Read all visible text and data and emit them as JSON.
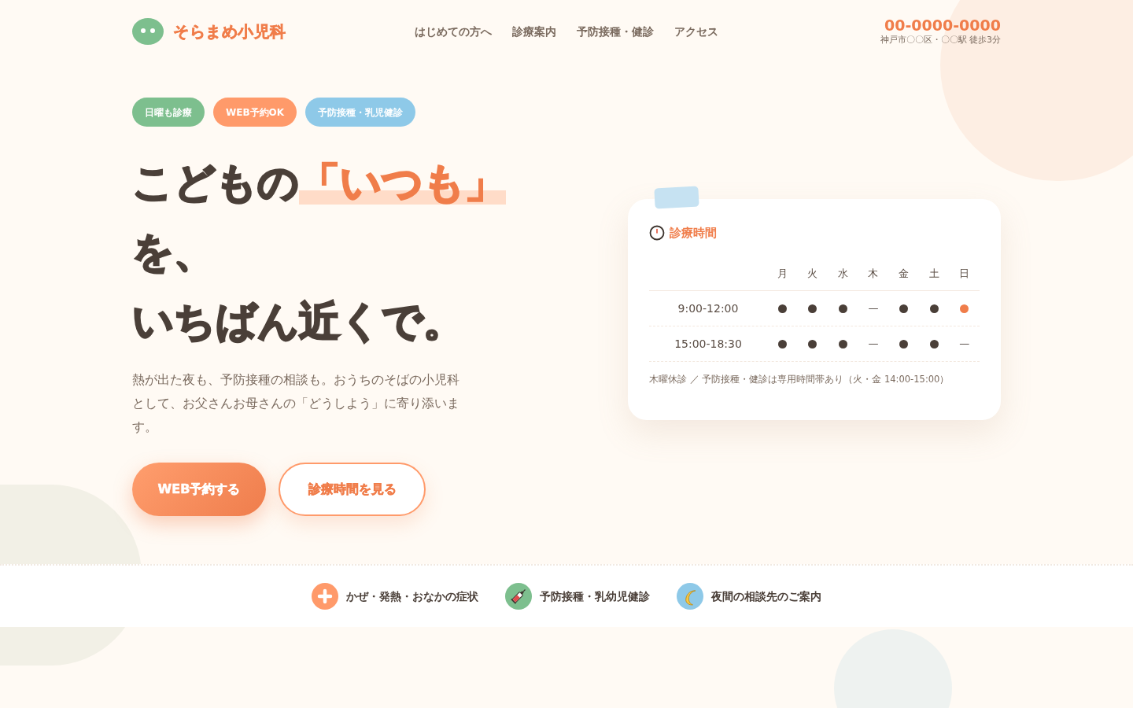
{
  "header": {
    "logo_text": "そらまめ小児科",
    "nav": [
      "はじめての方へ",
      "診療案内",
      "予防接種・健診",
      "アクセス"
    ],
    "phone": "00-0000-0000",
    "address": "神戸市〇〇区・〇〇駅 徒歩3分"
  },
  "hero": {
    "badges": [
      {
        "label": "日曜も診療",
        "color": "#7dbf8e"
      },
      {
        "label": "WEB予約OK",
        "color": "#ff9a6a"
      },
      {
        "label": "予防接種・乳児健診",
        "color": "#8ec9e8"
      }
    ],
    "headline": {
      "lines": [
        [
          {
            "text": "こどもの",
            "highlight": false
          },
          {
            "text": "「いつも」",
            "highlight": true
          }
        ],
        [
          {
            "text": "を、",
            "highlight": false
          }
        ],
        [
          {
            "text": "いちばん近くで。",
            "highlight": false
          }
        ]
      ]
    },
    "description": "熱が出た夜も、予防接種の相談も。おうちのそばの小児科として、お父さんお母さんの「どうしよう」に寄り添います。",
    "buttons": [
      {
        "label": "WEB予約する",
        "kind": "primary"
      },
      {
        "label": "診療時間を見る",
        "kind": "secondary"
      }
    ]
  },
  "hours_card": {
    "title": "診療時間",
    "days": [
      "月",
      "火",
      "水",
      "木",
      "金",
      "土",
      "日"
    ],
    "rows": [
      {
        "time": "9:00-12:00",
        "slots": [
          {
            "kind": "dot",
            "color": "#4a3f38"
          },
          {
            "kind": "dot",
            "color": "#4a3f38"
          },
          {
            "kind": "dot",
            "color": "#4a3f38"
          },
          {
            "kind": "closed",
            "text": "—"
          },
          {
            "kind": "dot",
            "color": "#4a3f38"
          },
          {
            "kind": "dot",
            "color": "#4a3f38"
          },
          {
            "kind": "dot",
            "color": "#f07d4a"
          }
        ]
      },
      {
        "time": "15:00-18:30",
        "slots": [
          {
            "kind": "dot",
            "color": "#4a3f38"
          },
          {
            "kind": "dot",
            "color": "#4a3f38"
          },
          {
            "kind": "dot",
            "color": "#4a3f38"
          },
          {
            "kind": "closed",
            "text": "—"
          },
          {
            "kind": "dot",
            "color": "#4a3f38"
          },
          {
            "kind": "dot",
            "color": "#4a3f38"
          },
          {
            "kind": "closed",
            "text": "—"
          }
        ]
      }
    ],
    "note": "木曜休診 ／ 予防接種・健診は専用時間帯あり（火・金 14:00-15:00）"
  },
  "quick_links": [
    {
      "label": "かぜ・発熱・おなかの症状",
      "kind": "plus",
      "color": "#ff9a6a"
    },
    {
      "label": "予防接種・乳幼児健診",
      "kind": "syringe",
      "color": "#7dbf8e"
    },
    {
      "label": "夜間の相談先のご案内",
      "kind": "moon",
      "color": "#8ec9e8"
    }
  ]
}
